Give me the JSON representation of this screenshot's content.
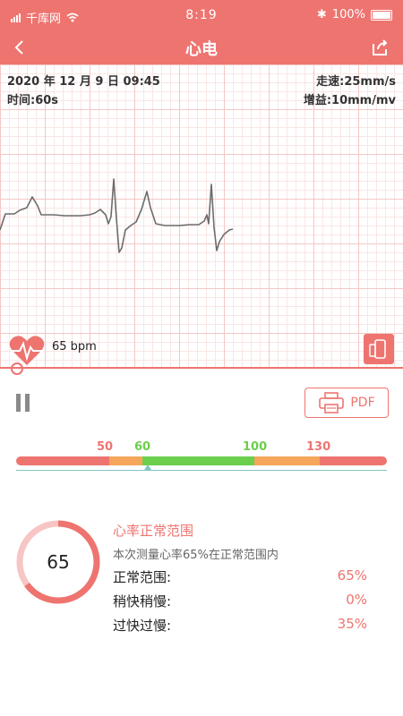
{
  "status": {
    "carrier": "千库网",
    "time": "8:19",
    "battery": "100%"
  },
  "nav": {
    "title": "心电",
    "back_icon": "chevron-left-icon",
    "share_icon": "share-icon"
  },
  "ecg": {
    "datetime": "2020 年 12 月 9 日 09:45",
    "duration": "时间:60s",
    "speed": "走速:25mm/s",
    "gain": "增益:10mm/mv",
    "bpm": "65 bpm"
  },
  "controls": {
    "pdf_label": "PDF"
  },
  "scale": {
    "labels": [
      "50",
      "60",
      "100",
      "130"
    ],
    "colors": {
      "red": "#ee7470",
      "orange": "#f5a65b",
      "green": "#6cce4d"
    }
  },
  "result": {
    "value": "65",
    "percent_normal": 65,
    "title": "心率正常范围",
    "description": "本次测量心率65%在正常范围内",
    "rows": [
      {
        "label": "正常范围:",
        "value": "65%"
      },
      {
        "label": "稍快稍慢:",
        "value": "0%"
      },
      {
        "label": "过快过慢:",
        "value": "35%"
      }
    ]
  }
}
